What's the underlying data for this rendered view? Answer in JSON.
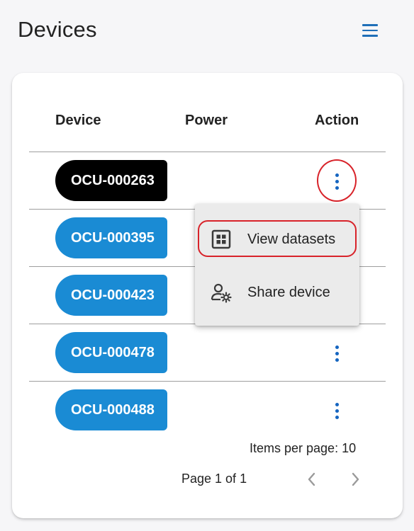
{
  "header": {
    "title": "Devices",
    "menu_icon": "hamburger-menu-icon"
  },
  "table": {
    "columns": [
      "Device",
      "Power",
      "Action"
    ],
    "rows": [
      {
        "device": "OCU-000263",
        "selected": true
      },
      {
        "device": "OCU-000395",
        "selected": false
      },
      {
        "device": "OCU-000423",
        "selected": false
      },
      {
        "device": "OCU-000478",
        "selected": false
      },
      {
        "device": "OCU-000488",
        "selected": false
      }
    ]
  },
  "context_menu": {
    "items": [
      {
        "label": "View datasets",
        "icon": "grid-dataset-icon"
      },
      {
        "label": "Share device",
        "icon": "user-settings-icon"
      }
    ]
  },
  "pagination": {
    "items_per_page": "Items per page: 10",
    "page_info": "Page 1 of 1"
  },
  "colors": {
    "accent": "#1a8bd4",
    "selected_chip": "#000000",
    "highlight": "#d8232a",
    "icon_blue": "#1565c0"
  }
}
